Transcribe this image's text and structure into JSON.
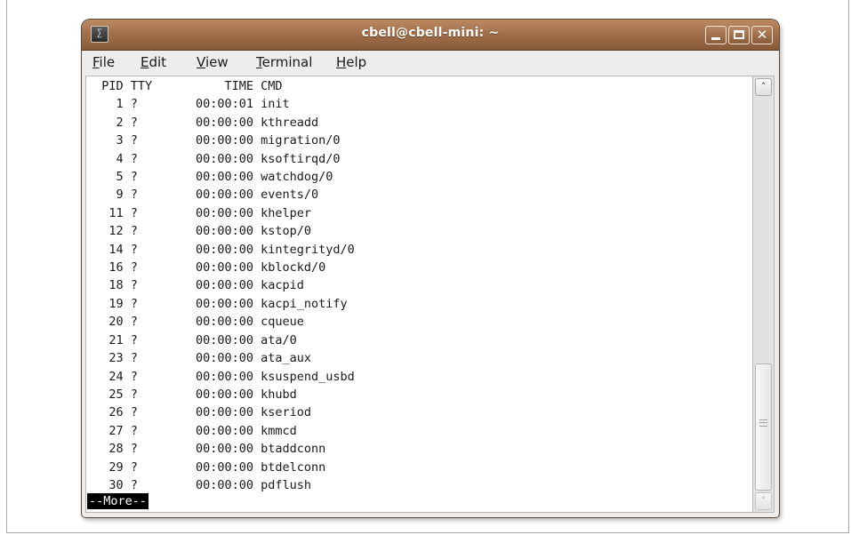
{
  "window": {
    "title": "cbell@cbell-mini: ~",
    "terminal_icon_glyph": "∑",
    "close_glyph": "✕"
  },
  "menu": {
    "file": {
      "mnemonic": "F",
      "rest": "ile"
    },
    "edit": {
      "mnemonic": "E",
      "rest": "dit"
    },
    "view": {
      "mnemonic": "V",
      "rest": "iew"
    },
    "terminal": {
      "pre": "",
      "mnemonic": "T",
      "rest": "erminal"
    },
    "help": {
      "mnemonic": "H",
      "rest": "elp"
    }
  },
  "terminal": {
    "header": {
      "pid": "PID",
      "tty": "TTY",
      "time": "TIME",
      "cmd": "CMD"
    },
    "processes": [
      {
        "pid": "1",
        "tty": "?",
        "time": "00:00:01",
        "cmd": "init"
      },
      {
        "pid": "2",
        "tty": "?",
        "time": "00:00:00",
        "cmd": "kthreadd"
      },
      {
        "pid": "3",
        "tty": "?",
        "time": "00:00:00",
        "cmd": "migration/0"
      },
      {
        "pid": "4",
        "tty": "?",
        "time": "00:00:00",
        "cmd": "ksoftirqd/0"
      },
      {
        "pid": "5",
        "tty": "?",
        "time": "00:00:00",
        "cmd": "watchdog/0"
      },
      {
        "pid": "9",
        "tty": "?",
        "time": "00:00:00",
        "cmd": "events/0"
      },
      {
        "pid": "11",
        "tty": "?",
        "time": "00:00:00",
        "cmd": "khelper"
      },
      {
        "pid": "12",
        "tty": "?",
        "time": "00:00:00",
        "cmd": "kstop/0"
      },
      {
        "pid": "14",
        "tty": "?",
        "time": "00:00:00",
        "cmd": "kintegrityd/0"
      },
      {
        "pid": "16",
        "tty": "?",
        "time": "00:00:00",
        "cmd": "kblockd/0"
      },
      {
        "pid": "18",
        "tty": "?",
        "time": "00:00:00",
        "cmd": "kacpid"
      },
      {
        "pid": "19",
        "tty": "?",
        "time": "00:00:00",
        "cmd": "kacpi_notify"
      },
      {
        "pid": "20",
        "tty": "?",
        "time": "00:00:00",
        "cmd": "cqueue"
      },
      {
        "pid": "21",
        "tty": "?",
        "time": "00:00:00",
        "cmd": "ata/0"
      },
      {
        "pid": "23",
        "tty": "?",
        "time": "00:00:00",
        "cmd": "ata_aux"
      },
      {
        "pid": "24",
        "tty": "?",
        "time": "00:00:00",
        "cmd": "ksuspend_usbd"
      },
      {
        "pid": "25",
        "tty": "?",
        "time": "00:00:00",
        "cmd": "khubd"
      },
      {
        "pid": "26",
        "tty": "?",
        "time": "00:00:00",
        "cmd": "kseriod"
      },
      {
        "pid": "27",
        "tty": "?",
        "time": "00:00:00",
        "cmd": "kmmcd"
      },
      {
        "pid": "28",
        "tty": "?",
        "time": "00:00:00",
        "cmd": "btaddconn"
      },
      {
        "pid": "29",
        "tty": "?",
        "time": "00:00:00",
        "cmd": "btdelconn"
      },
      {
        "pid": "30",
        "tty": "?",
        "time": "00:00:00",
        "cmd": "pdflush"
      }
    ],
    "more_prompt": "--More--"
  },
  "scrollbar": {
    "up_glyph": "˄",
    "down_glyph": "˅",
    "position_fraction": 1.0
  },
  "icons": {
    "terminal": "terminal-app-icon",
    "minimize": "minimize-icon",
    "maximize": "maximize-icon",
    "close": "close-icon",
    "scroll_up": "chevron-up-icon",
    "scroll_down": "chevron-down-icon"
  },
  "colors": {
    "titlebar": "#a2714b",
    "terminal_bg": "#ffffff",
    "terminal_fg": "#1a1a1a",
    "prompt_bg": "#000000"
  }
}
